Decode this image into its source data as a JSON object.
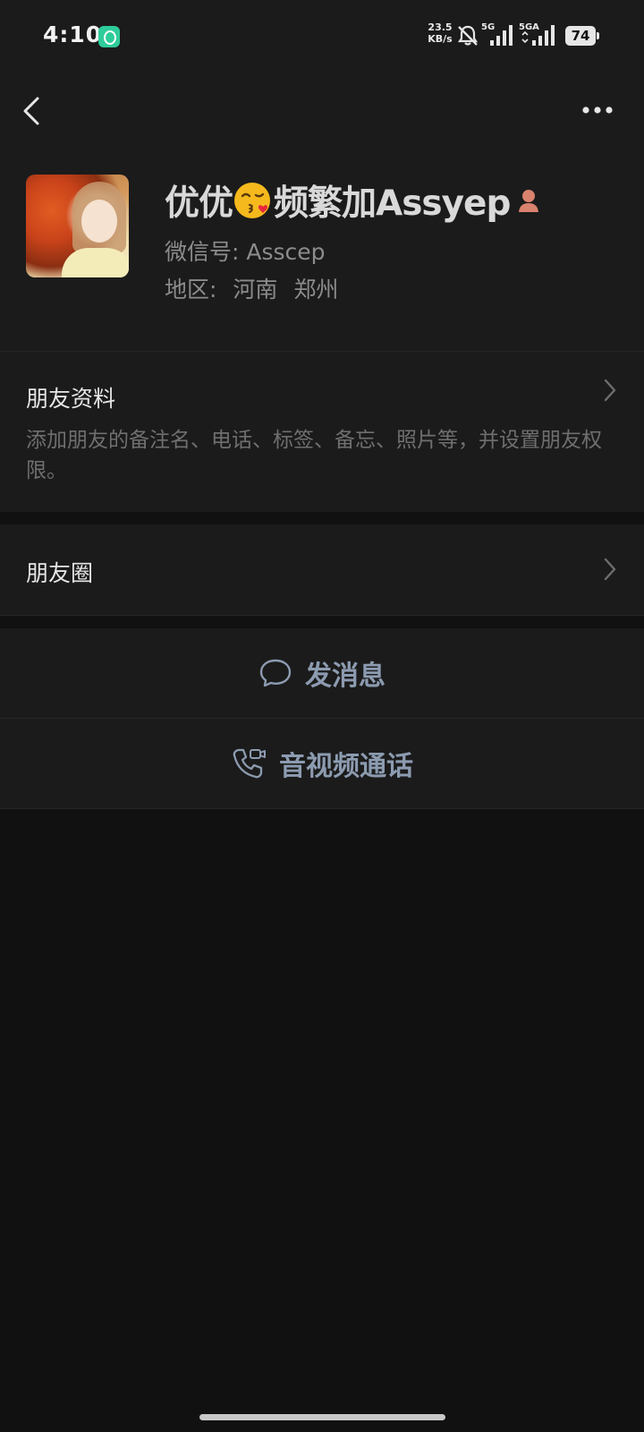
{
  "status_bar": {
    "time": "4:10",
    "net_speed_value": "23.5",
    "net_speed_unit": "KB/s",
    "signal_1_label": "5G",
    "signal_2_label": "5GA",
    "battery": "74"
  },
  "profile": {
    "name_prefix": "优优",
    "name_suffix": "频繁加Assyep",
    "wechat_id": "微信号:  Asscep",
    "region": "地区:  河南  郑州"
  },
  "rows": {
    "friend_info": {
      "title": "朋友资料",
      "description": "添加朋友的备注名、电话、标签、备忘、照片等，并设置朋友权限。"
    },
    "moments": {
      "title": "朋友圈"
    }
  },
  "actions": {
    "message_label": "发消息",
    "call_label": "音视频通话"
  },
  "colors": {
    "background": "#111111",
    "panel": "#1b1b1b",
    "action_text": "#8c9bb0"
  }
}
